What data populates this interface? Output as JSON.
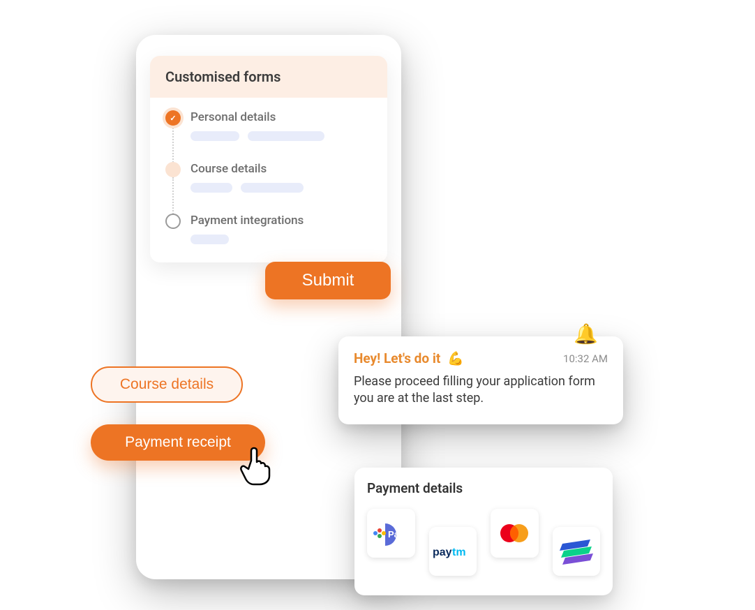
{
  "forms": {
    "header": "Customised forms",
    "steps": [
      {
        "label": "Personal details",
        "state": "done"
      },
      {
        "label": "Course details",
        "state": "current"
      },
      {
        "label": "Payment integrations",
        "state": "pending"
      }
    ],
    "submit_label": "Submit"
  },
  "pills": {
    "course_details": "Course details",
    "payment_receipt": "Payment receipt"
  },
  "notification": {
    "title": "Hey! Let's do it",
    "emoji": "💪",
    "time": "10:32 AM",
    "body": "Please proceed filling your application form you are at the last step."
  },
  "payment": {
    "title": "Payment details",
    "methods": [
      "gpay",
      "paytm",
      "mastercard",
      "razorpay"
    ]
  },
  "colors": {
    "accent": "#ed7424",
    "accent_light": "#fbe3d2",
    "header_bg": "#fdeee4"
  }
}
